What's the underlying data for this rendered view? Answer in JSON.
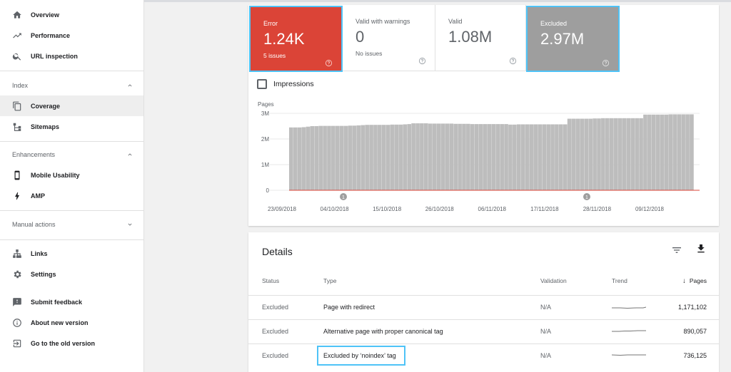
{
  "sidebar": {
    "top_items": [
      {
        "label": "Overview",
        "icon": "home-icon"
      },
      {
        "label": "Performance",
        "icon": "trending-up-icon"
      },
      {
        "label": "URL inspection",
        "icon": "search-icon"
      }
    ],
    "index_section": {
      "label": "Index",
      "items": [
        {
          "label": "Coverage",
          "icon": "coverage-icon",
          "active": true
        },
        {
          "label": "Sitemaps",
          "icon": "sitemap-icon"
        }
      ]
    },
    "enhancements_section": {
      "label": "Enhancements",
      "items": [
        {
          "label": "Mobile Usability",
          "icon": "smartphone-icon"
        },
        {
          "label": "AMP",
          "icon": "bolt-icon"
        }
      ]
    },
    "manual_actions_section": {
      "label": "Manual actions"
    },
    "bottom_items": [
      {
        "label": "Links",
        "icon": "links-icon"
      },
      {
        "label": "Settings",
        "icon": "gear-icon"
      }
    ],
    "footer_items": [
      {
        "label": "Submit feedback",
        "icon": "feedback-icon"
      },
      {
        "label": "About new version",
        "icon": "info-icon"
      },
      {
        "label": "Go to the old version",
        "icon": "exit-icon"
      }
    ]
  },
  "summary": {
    "error": {
      "label": "Error",
      "value": "1.24K",
      "sub": "5 issues",
      "color": "#db4437"
    },
    "valid_warnings": {
      "label": "Valid with warnings",
      "value": "0",
      "sub": "No issues"
    },
    "valid": {
      "label": "Valid",
      "value": "1.08M"
    },
    "excluded": {
      "label": "Excluded",
      "value": "2.97M",
      "color": "#9e9e9e"
    },
    "selected_border_color": "#4fc3f7",
    "impressions_label": "Impressions",
    "impressions_checked": false
  },
  "chart_data": {
    "type": "bar",
    "ylabel": "Pages",
    "y_ticks": [
      "3M",
      "2M",
      "1M",
      "0"
    ],
    "ylim": [
      0,
      3000000
    ],
    "x_tick_labels": [
      "23/09/2018",
      "04/10/2018",
      "15/10/2018",
      "26/10/2018",
      "06/11/2018",
      "17/11/2018",
      "28/11/2018",
      "09/12/2018"
    ],
    "bar_color": "#bdbdbd",
    "error_line_color": "#db4437",
    "annotations": [
      {
        "label": "1",
        "near": "04/10/2018"
      },
      {
        "label": "1",
        "near": "28/11/2018"
      }
    ],
    "series": [
      {
        "name": "Excluded",
        "values": [
          2450000,
          2450000,
          2450000,
          2460000,
          2480000,
          2500000,
          2500000,
          2510000,
          2510000,
          2510000,
          2510000,
          2510000,
          2510000,
          2510000,
          2520000,
          2520000,
          2530000,
          2540000,
          2550000,
          2550000,
          2550000,
          2550000,
          2550000,
          2550000,
          2560000,
          2560000,
          2560000,
          2570000,
          2580000,
          2610000,
          2610000,
          2610000,
          2610000,
          2600000,
          2600000,
          2600000,
          2600000,
          2600000,
          2600000,
          2590000,
          2590000,
          2590000,
          2590000,
          2580000,
          2580000,
          2580000,
          2580000,
          2580000,
          2580000,
          2580000,
          2580000,
          2580000,
          2560000,
          2560000,
          2570000,
          2570000,
          2570000,
          2570000,
          2570000,
          2570000,
          2570000,
          2570000,
          2570000,
          2570000,
          2570000,
          2570000,
          2790000,
          2790000,
          2790000,
          2790000,
          2790000,
          2790000,
          2800000,
          2800000,
          2810000,
          2810000,
          2810000,
          2810000,
          2810000,
          2810000,
          2810000,
          2810000,
          2810000,
          2810000,
          2950000,
          2950000,
          2950000,
          2950000,
          2950000,
          2950000,
          2960000,
          2960000,
          2960000,
          2960000,
          2960000,
          2960000
        ]
      },
      {
        "name": "Error",
        "values": [
          1240,
          1240
        ]
      }
    ]
  },
  "details": {
    "title": "Details",
    "columns": {
      "status": "Status",
      "type": "Type",
      "validation": "Validation",
      "trend": "Trend",
      "pages": "Pages"
    },
    "sort_indicator": "↓",
    "rows": [
      {
        "status": "Excluded",
        "type": "Page with redirect",
        "validation": "N/A",
        "pages": "1,171,102"
      },
      {
        "status": "Excluded",
        "type": "Alternative page with proper canonical tag",
        "validation": "N/A",
        "pages": "890,057"
      },
      {
        "status": "Excluded",
        "type": "Excluded by ‘noindex’ tag",
        "validation": "N/A",
        "pages": "736,125"
      }
    ]
  }
}
